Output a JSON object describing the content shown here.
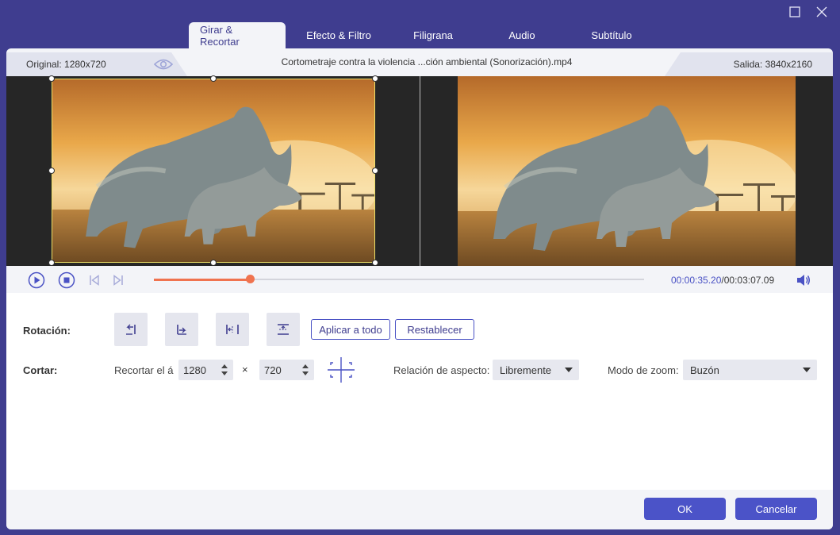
{
  "window": {
    "maximize_icon": "maximize-icon",
    "close_icon": "close-icon"
  },
  "tabs": [
    {
      "label": "Girar & Recortar",
      "active": true
    },
    {
      "label": "Efecto & Filtro",
      "active": false
    },
    {
      "label": "Filigrana",
      "active": false
    },
    {
      "label": "Audio",
      "active": false
    },
    {
      "label": "Subtítulo",
      "active": false
    }
  ],
  "infobar": {
    "original": "Original: 1280x720",
    "filename": "Cortometraje contra la violencia ...ción ambiental (Sonorización).mp4",
    "output": "Salida: 3840x2160"
  },
  "player": {
    "current_time": "00:00:35.20",
    "separator": "/",
    "total_time": "00:03:07.09",
    "progress": 0.195
  },
  "rotation": {
    "label": "Rotación:",
    "buttons": [
      "rotate-left-icon",
      "rotate-right-icon",
      "flip-horizontal-icon",
      "flip-vertical-icon"
    ],
    "apply_all": "Aplicar a todo",
    "reset": "Restablecer"
  },
  "crop": {
    "label": "Cortar:",
    "area_label": "Recortar el á",
    "width": "1280",
    "times": "×",
    "height": "720",
    "aspect_label": "Relación de aspecto:",
    "aspect_value": "Libremente",
    "zoom_label": "Modo de zoom:",
    "zoom_value": "Buzón"
  },
  "footer": {
    "ok": "OK",
    "cancel": "Cancelar"
  },
  "colors": {
    "brand": "#3f3d8f",
    "accent": "#4b53c8",
    "progress": "#f0734f",
    "crop_border": "#ede067"
  }
}
